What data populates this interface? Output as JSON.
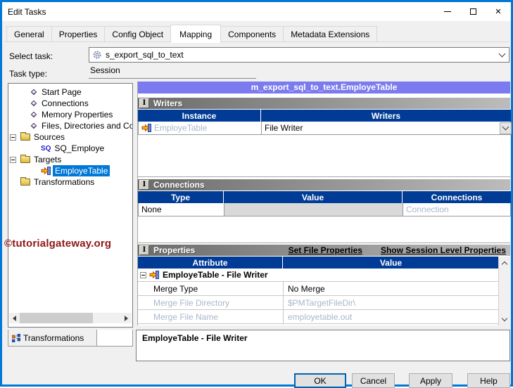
{
  "colors": {
    "window_border": "#0078d7",
    "table_header_blue": "#003c96",
    "mapping_header_purple": "#7b7bef",
    "selection_blue": "#0078d7",
    "disabled_text": "#a9b7c9",
    "watermark_red": "#8f1616"
  },
  "titlebar": {
    "title": "Edit Tasks"
  },
  "tabs": {
    "items": [
      {
        "label": "General"
      },
      {
        "label": "Properties"
      },
      {
        "label": "Config Object"
      },
      {
        "label": "Mapping"
      },
      {
        "label": "Components"
      },
      {
        "label": "Metadata Extensions"
      }
    ],
    "active": "Mapping"
  },
  "form": {
    "select_task_label": "Select task:",
    "select_task_value": "s_export_sql_to_text",
    "task_type_label": "Task type:",
    "task_type_value": "Session"
  },
  "navigator": {
    "items": [
      {
        "label": "Start Page"
      },
      {
        "label": "Connections"
      },
      {
        "label": "Memory Properties"
      },
      {
        "label": "Files, Directories and Com"
      },
      {
        "label": "Sources"
      },
      {
        "label": "SQ_Employe"
      },
      {
        "label": "Targets"
      },
      {
        "label": "EmployeTable"
      },
      {
        "label": "Transformations"
      }
    ],
    "bottom_tab": "Transformations"
  },
  "watermark": "©tutorialgateway.org",
  "mapping": {
    "header": "m_export_sql_to_text.EmployeTable",
    "writers": {
      "title": "Writers",
      "col_instance": "Instance",
      "col_writers": "Writers",
      "row": {
        "instance": "EmployeTable",
        "writer": "File Writer"
      }
    },
    "connections": {
      "title": "Connections",
      "col_type": "Type",
      "col_value": "Value",
      "col_connections": "Connections",
      "row": {
        "type": "None",
        "value": "",
        "connection": "Connection"
      }
    },
    "properties": {
      "title": "Properties",
      "link_set_file": "Set File Properties",
      "link_show_session": "Show Session Level Properties",
      "col_attribute": "Attribute",
      "col_value": "Value",
      "group": "EmployeTable - File Writer",
      "rows": [
        {
          "attribute": "Merge Type",
          "value": "No Merge"
        },
        {
          "attribute": "Merge File Directory",
          "value": "$PMTargetFileDir\\"
        },
        {
          "attribute": "Merge File Name",
          "value": "employetable.out"
        }
      ]
    },
    "description": "EmployeTable - File Writer"
  },
  "footer": {
    "buttons": [
      {
        "label": "OK"
      },
      {
        "label": "Cancel"
      },
      {
        "label": "Apply"
      },
      {
        "label": "Help"
      }
    ]
  }
}
